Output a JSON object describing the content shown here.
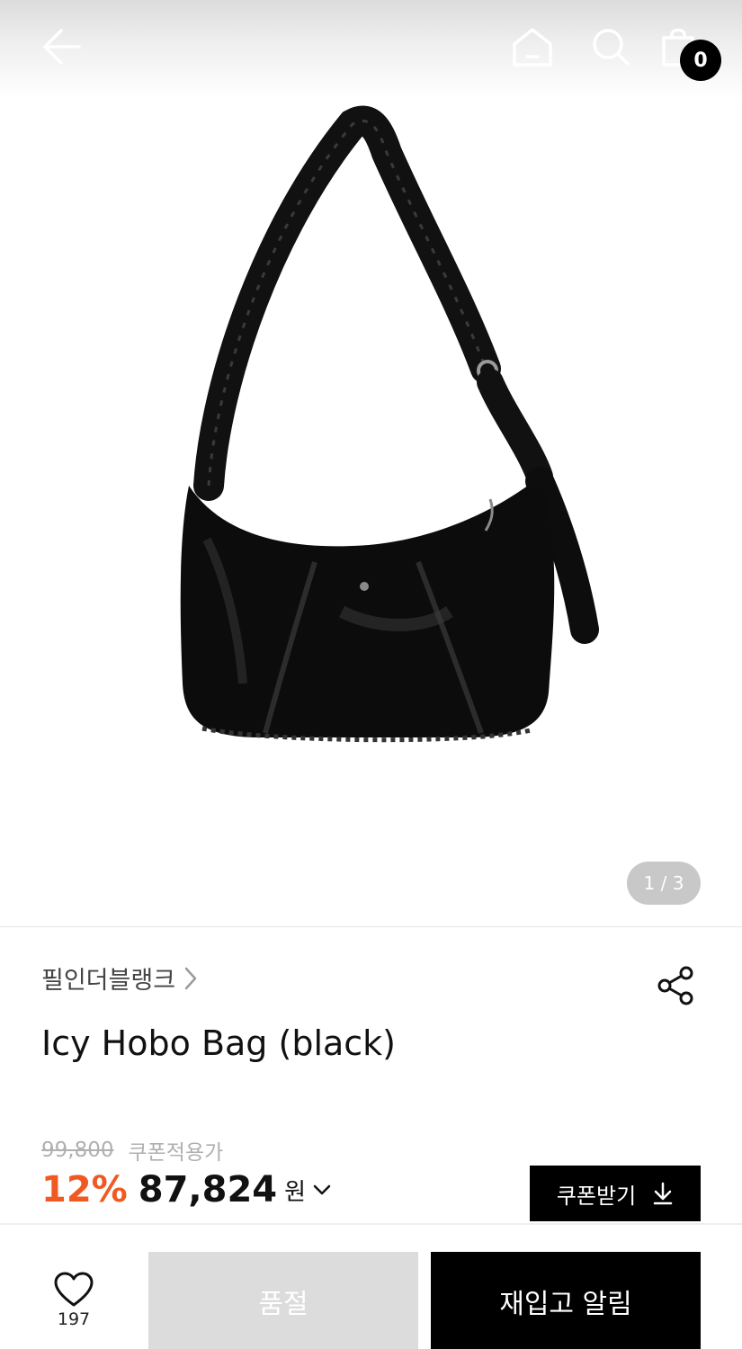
{
  "header": {
    "back_icon": "arrow-left-icon",
    "home_icon": "home-icon",
    "search_icon": "search-icon",
    "cart_icon": "shopping-bag-icon",
    "cart_count": "0"
  },
  "gallery": {
    "image_subject": "black quilted hobo shoulder bag",
    "page_indicator": "1 / 3",
    "current_image": 1,
    "total_images": 3
  },
  "product": {
    "brand": "필인더블랭크",
    "brand_chevron_icon": "chevron-right-icon",
    "share_icon": "share-icon",
    "title": "Icy Hobo Bag (black)",
    "original_price": "99,800",
    "coupon_note": "쿠폰적용가",
    "discount": "12%",
    "price": "87,824",
    "currency": "원",
    "price_chevron_icon": "chevron-down-icon",
    "coupon_button": "쿠폰받기",
    "coupon_icon": "download-icon",
    "discount_color": "#f05a22"
  },
  "bottom_bar": {
    "wish_icon": "heart-icon",
    "wish_count": "197",
    "soldout_label": "품절",
    "restock_label": "재입고 알림"
  }
}
